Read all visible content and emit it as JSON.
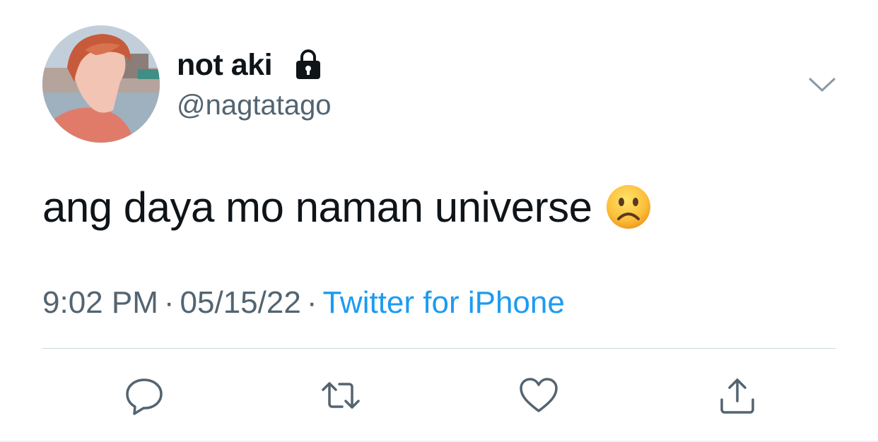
{
  "tweet": {
    "display_name": "not aki",
    "handle": "@nagtatago",
    "protected": true,
    "text": "ang daya mo naman universe",
    "emoji": "frowning-face",
    "time": "9:02 PM",
    "date": "05/15/22",
    "source": "Twitter for iPhone",
    "separator": "·"
  },
  "actions": [
    "reply-icon",
    "retweet-icon",
    "like-icon",
    "share-icon"
  ],
  "colors": {
    "text": "#0f1419",
    "secondary": "#536471",
    "link": "#1d9bf0",
    "divider": "#cfd9de"
  }
}
